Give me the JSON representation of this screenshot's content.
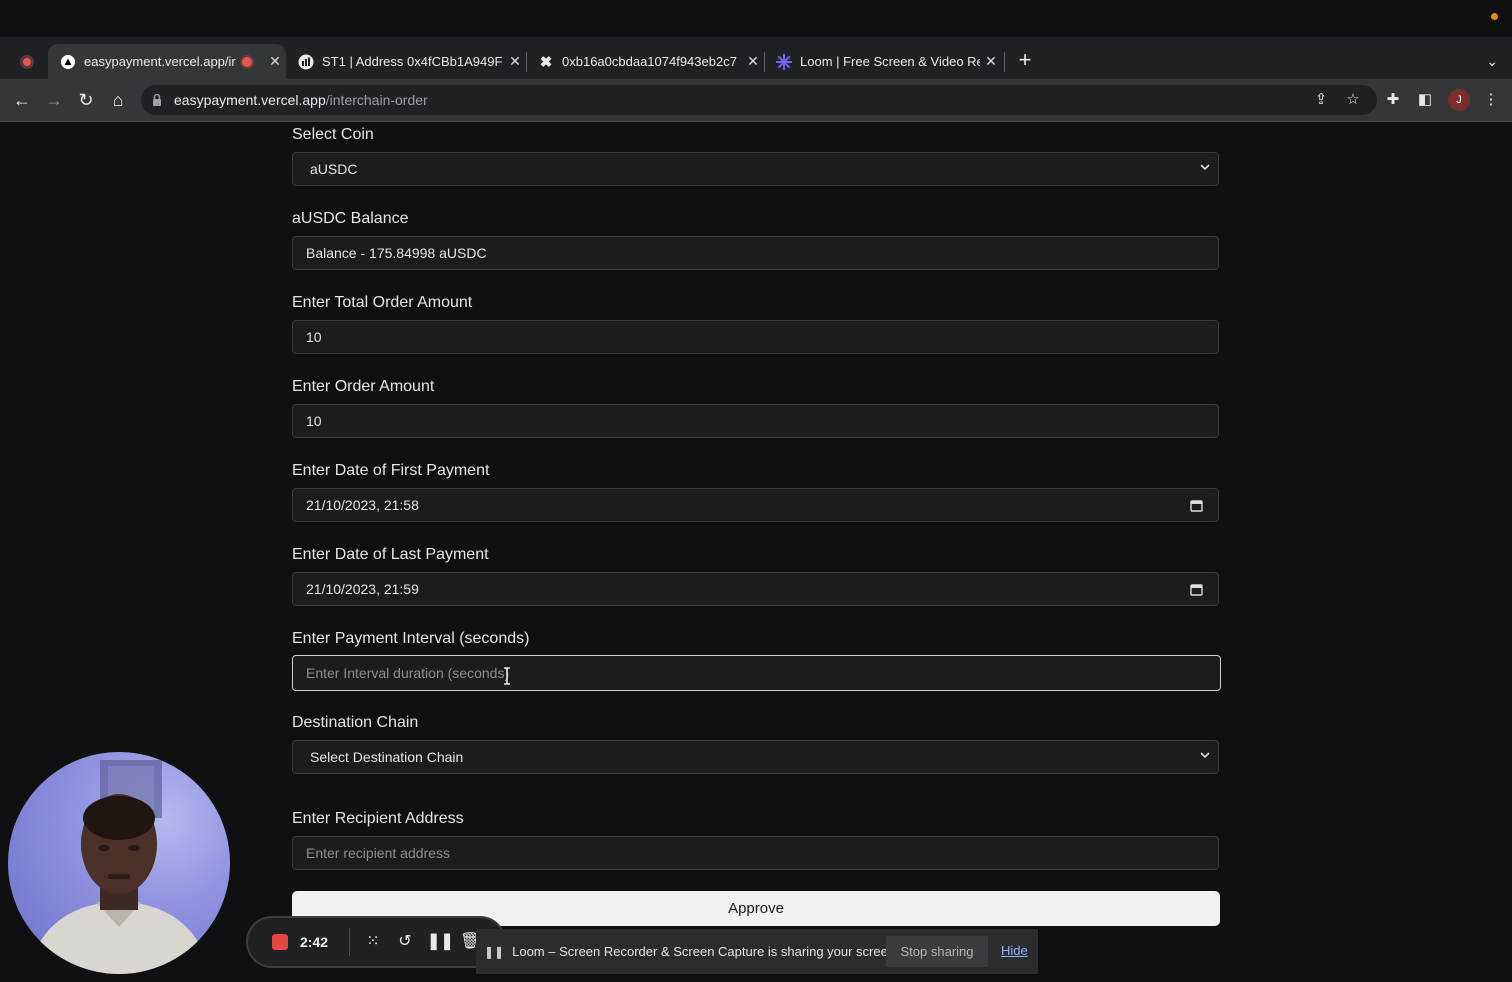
{
  "browser": {
    "tabs": [
      {
        "title": "easypayment.vercel.app/ir",
        "active": true,
        "favicon": "vercel-triangle-icon"
      },
      {
        "title": "ST1 | Address 0x4fCBb1A949F",
        "active": false,
        "favicon": "etherscan-icon"
      },
      {
        "title": "0xb16a0cbdaa1074f943eb2c7",
        "active": false,
        "favicon": "squid-icon"
      },
      {
        "title": "Loom | Free Screen & Video Re",
        "active": false,
        "favicon": "loom-icon"
      }
    ],
    "url_host": "easypayment.vercel.app",
    "url_path": "/interchain-order",
    "profile_initial": "J"
  },
  "form": {
    "select_coin": {
      "label": "Select Coin",
      "value": "aUSDC"
    },
    "balance": {
      "label": "aUSDC Balance",
      "value": "Balance - 175.84998 aUSDC"
    },
    "total_order_amount": {
      "label": "Enter Total Order Amount",
      "value": "10"
    },
    "order_amount": {
      "label": "Enter Order Amount",
      "value": "10"
    },
    "first_payment": {
      "label": "Enter Date of First Payment",
      "value": "21/10/2023, 21:58"
    },
    "last_payment": {
      "label": "Enter Date of Last Payment",
      "value": "21/10/2023, 21:59"
    },
    "payment_interval": {
      "label": "Enter Payment Interval (seconds)",
      "placeholder": "Enter Interval duration (seconds)"
    },
    "destination_chain": {
      "label": "Destination Chain",
      "value": "Select Destination Chain"
    },
    "recipient_address": {
      "label": "Enter Recipient Address",
      "placeholder": "Enter recipient address"
    },
    "approve_label": "Approve"
  },
  "loom": {
    "timer": "2:42",
    "share_message": "Loom – Screen Recorder & Screen Capture is sharing your screen.",
    "stop_sharing_label": "Stop sharing",
    "hide_label": "Hide"
  },
  "colors": {
    "page_bg": "#101012",
    "field_bg": "#1c1c1e",
    "approve_bg": "#f1f1f3",
    "record_red": "#e2463f",
    "link_blue": "#8ab4f8"
  }
}
